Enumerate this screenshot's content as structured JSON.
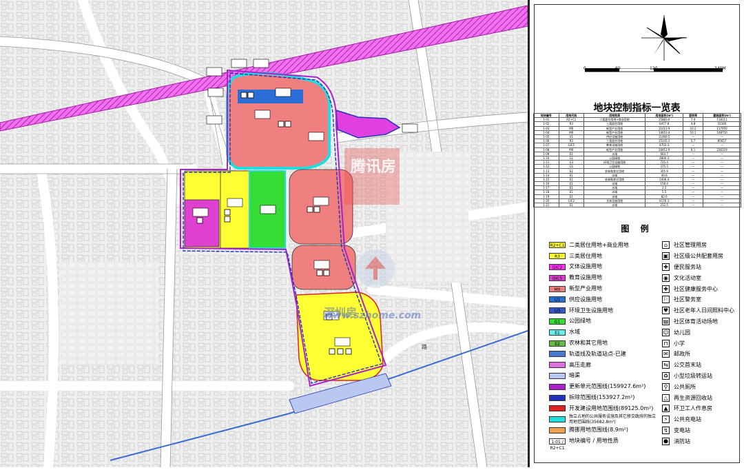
{
  "watermark": {
    "logo_text": "腾讯房",
    "site": "www.szhome.com",
    "site_label": "深圳房"
  },
  "map": {
    "road_label": "路"
  },
  "scale_bar": {
    "ticks": [
      "0",
      "60",
      "120",
      "240M"
    ]
  },
  "index_table": {
    "title": "地块控制指标一览表",
    "headers": [
      "地块编号",
      "用地代码",
      "用地性质",
      "用地面积(m²)",
      "容积率",
      "建筑面积(m²)"
    ],
    "rows": [
      [
        "1-01",
        "R2+C1",
        "二类居住用地+商业用地",
        "15883.6",
        "7.4",
        "118111"
      ],
      [
        "1-02",
        "R3",
        "三类居住用地",
        "6477.8",
        "4.8",
        "31160"
      ],
      [
        "1-03",
        "M0",
        "新型产业用地",
        "11013.9",
        "10.2",
        "117050"
      ],
      [
        "1-04",
        "M0",
        "新型产业用地",
        "14653.4",
        "10.1",
        "148750"
      ],
      [
        "1-05",
        "U1",
        "供应设施用地",
        "11466.5",
        "—",
        "—"
      ],
      [
        "1-06",
        "R3",
        "三类居住用地",
        "15145.2",
        "5.7",
        "85657"
      ],
      [
        "1-07",
        "GIC5",
        "教育设施用地",
        "8703.3",
        "—",
        "—"
      ],
      [
        "1-08",
        "M0",
        "新型产业用地",
        "28412.9",
        "8.1",
        "236119"
      ],
      [
        "1-09",
        "E1",
        "水域",
        "664.7",
        "—",
        "—"
      ],
      [
        "1-10",
        "G1",
        "公园绿地",
        "4800.3",
        "—",
        "—"
      ],
      [
        "1-11",
        "U3",
        "环境卫生设施用地",
        "725.4",
        "—",
        "—"
      ],
      [
        "1-12",
        "G1",
        "公园绿地",
        "375.5",
        "—",
        "—"
      ],
      [
        "1-13",
        "E2",
        "农林和其它用地",
        "305.9",
        "—",
        "—"
      ],
      [
        "1-14",
        "E1",
        "水域",
        "40.6",
        "—",
        "—"
      ],
      [
        "1-15",
        "E2",
        "农林和其它用地",
        "2406.4",
        "—",
        "—"
      ],
      [
        "1-16",
        "E1",
        "水域",
        "158.4",
        "—",
        "—"
      ],
      [
        "1-17",
        "E1",
        "水域",
        "2.2",
        "—",
        "—"
      ],
      [
        "1-18",
        "E1",
        "水域",
        "5.5",
        "—",
        "—"
      ],
      [
        "1-19",
        "E1",
        "水域",
        "82.6",
        "—",
        "—"
      ],
      [
        "1-20",
        "GIC2",
        "文体设施用地",
        "6176.3",
        "—",
        "—"
      ],
      [
        "1-21",
        "E1",
        "水域",
        "212.5",
        "—",
        "—"
      ]
    ]
  },
  "legend": {
    "title": "图 例",
    "land_use": [
      {
        "code": "R2+C1",
        "label": "二类居住用地+商业用地",
        "color": "#ffff33"
      },
      {
        "code": "R3",
        "label": "三类居住用地",
        "color": "#ffff33"
      },
      {
        "code": "GIC2",
        "label": "文体设施用地",
        "color": "#ff33ff"
      },
      {
        "code": "GIC5",
        "label": "教育设施用地",
        "color": "#e040d0"
      },
      {
        "code": "M0",
        "label": "新型产业用地",
        "color": "#f08080"
      },
      {
        "code": "U1",
        "label": "供应设施用地",
        "color": "#2a6fd6"
      },
      {
        "code": "U3",
        "label": "环境卫生设施用地",
        "color": "#3355cc"
      },
      {
        "code": "G1",
        "label": "公园绿地",
        "color": "#33dd33"
      },
      {
        "code": "E1",
        "label": "水域",
        "color": "#66eeee"
      },
      {
        "code": "E2",
        "label": "农林和其它用地",
        "color": "#66bb44"
      },
      {
        "code": "",
        "label": "轨道线及轨道站点-已建",
        "color": "#4a7ad0"
      },
      {
        "code": "",
        "label": "高压走廊",
        "color": "#e070e0"
      },
      {
        "code": "",
        "label": "暗渠",
        "color": "#b8c8f0"
      },
      {
        "code": "",
        "label": "更新单元范围线(159927.6m²)",
        "color": "#aa22cc"
      },
      {
        "code": "",
        "label": "拆除范围线(153927.2m²)",
        "color": "#2233bb"
      },
      {
        "code": "",
        "label": "开发建设用地范围线(89125.0m²)",
        "color": "#dd2222"
      },
      {
        "code": "",
        "label": "独立占地的公共服务设施及其它移交政府的独立用地范围线(35682.8m²)",
        "color": "#22dddd"
      },
      {
        "code": "",
        "label": "腾挪用地范围线(8.9m²)",
        "color": "#f0a050"
      },
      {
        "code": "1-01 / R2+C1",
        "label": "地块编号 / 用地性质",
        "color": "#ffffff"
      }
    ],
    "facilities": [
      {
        "icon": "community-management-icon",
        "label": "社区管理用房"
      },
      {
        "icon": "community-service-icon",
        "label": "社区级公共配套用房"
      },
      {
        "icon": "convenience-service-icon",
        "label": "便民服务站"
      },
      {
        "icon": "culture-room-icon",
        "label": "文化活动室"
      },
      {
        "icon": "health-center-icon",
        "label": "社区健康服务中心"
      },
      {
        "icon": "police-office-icon",
        "label": "社区警务室"
      },
      {
        "icon": "elderly-daycare-icon",
        "label": "社区老年人日间照料中心"
      },
      {
        "icon": "sports-venue-icon",
        "label": "社区体育活动场地"
      },
      {
        "icon": "kindergarten-icon",
        "label": "幼儿园"
      },
      {
        "icon": "primary-school-icon",
        "label": "小学"
      },
      {
        "icon": "post-office-icon",
        "label": "邮政所"
      },
      {
        "icon": "bus-terminal-icon",
        "label": "公交首末站"
      },
      {
        "icon": "garbage-transfer-icon",
        "label": "小型垃圾转运站"
      },
      {
        "icon": "public-toilet-icon",
        "label": "公共厕所"
      },
      {
        "icon": "recycling-station-icon",
        "label": "再生资源回收站"
      },
      {
        "icon": "sanitation-workroom-icon",
        "label": "环卫工人作息房"
      },
      {
        "icon": "ev-charging-icon",
        "label": "公共充电站"
      },
      {
        "icon": "substation-icon",
        "label": "变电站"
      },
      {
        "icon": "fire-station-icon",
        "label": "消防站"
      }
    ]
  }
}
